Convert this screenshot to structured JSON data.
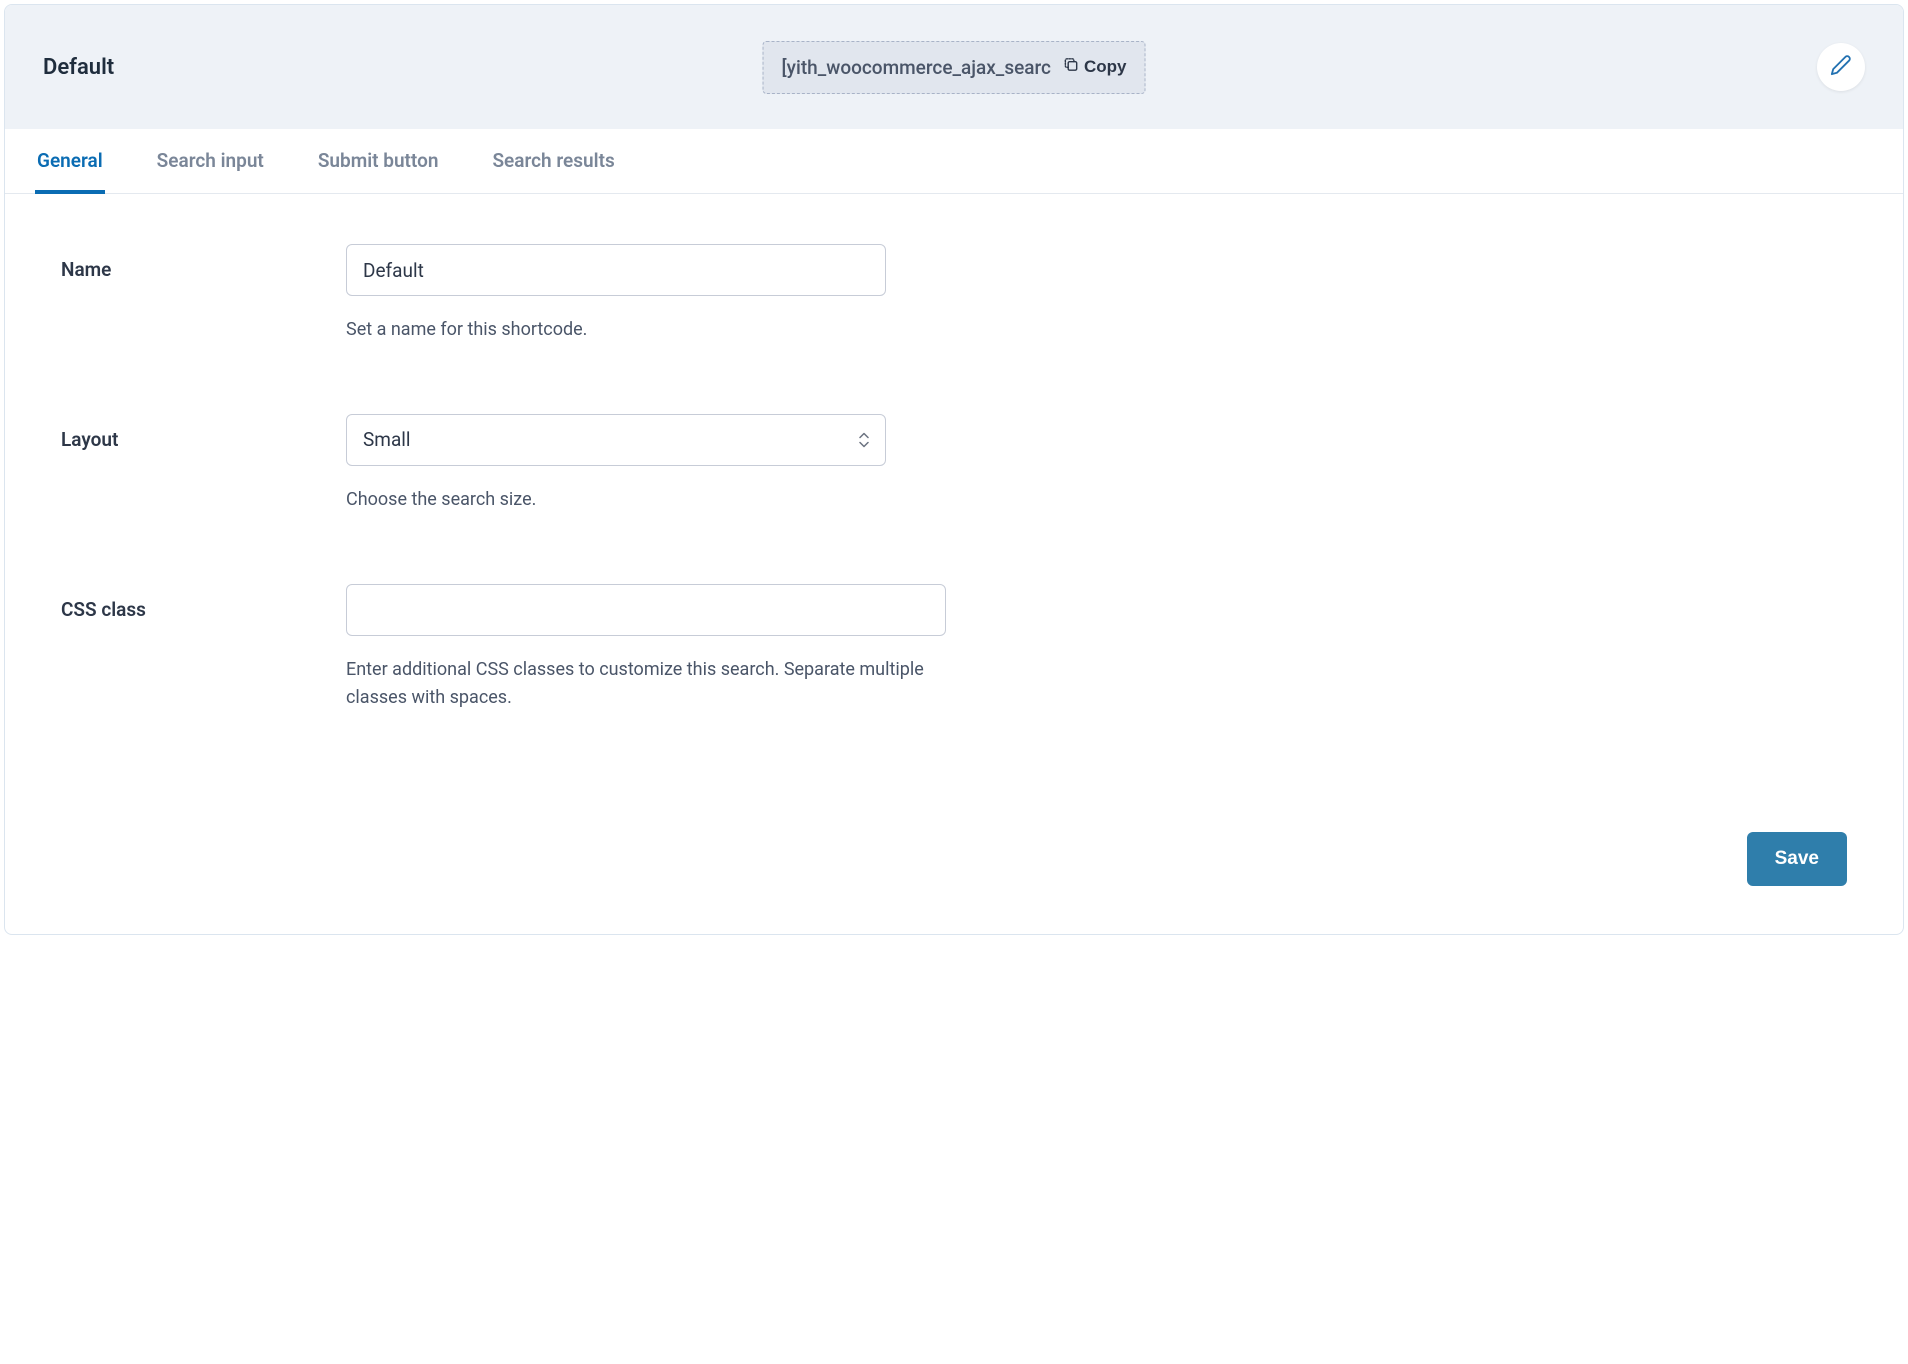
{
  "header": {
    "title": "Default",
    "shortcode": "[yith_woocommerce_ajax_searc",
    "copy_label": "Copy"
  },
  "tabs": [
    {
      "label": "General",
      "active": true
    },
    {
      "label": "Search input",
      "active": false
    },
    {
      "label": "Submit button",
      "active": false
    },
    {
      "label": "Search results",
      "active": false
    }
  ],
  "fields": {
    "name": {
      "label": "Name",
      "value": "Default",
      "help": "Set a name for this shortcode."
    },
    "layout": {
      "label": "Layout",
      "value": "Small",
      "help": "Choose the search size."
    },
    "css_class": {
      "label": "CSS class",
      "value": "",
      "help": "Enter additional CSS classes to customize this search. Separate multiple classes with spaces."
    }
  },
  "footer": {
    "save_label": "Save"
  }
}
